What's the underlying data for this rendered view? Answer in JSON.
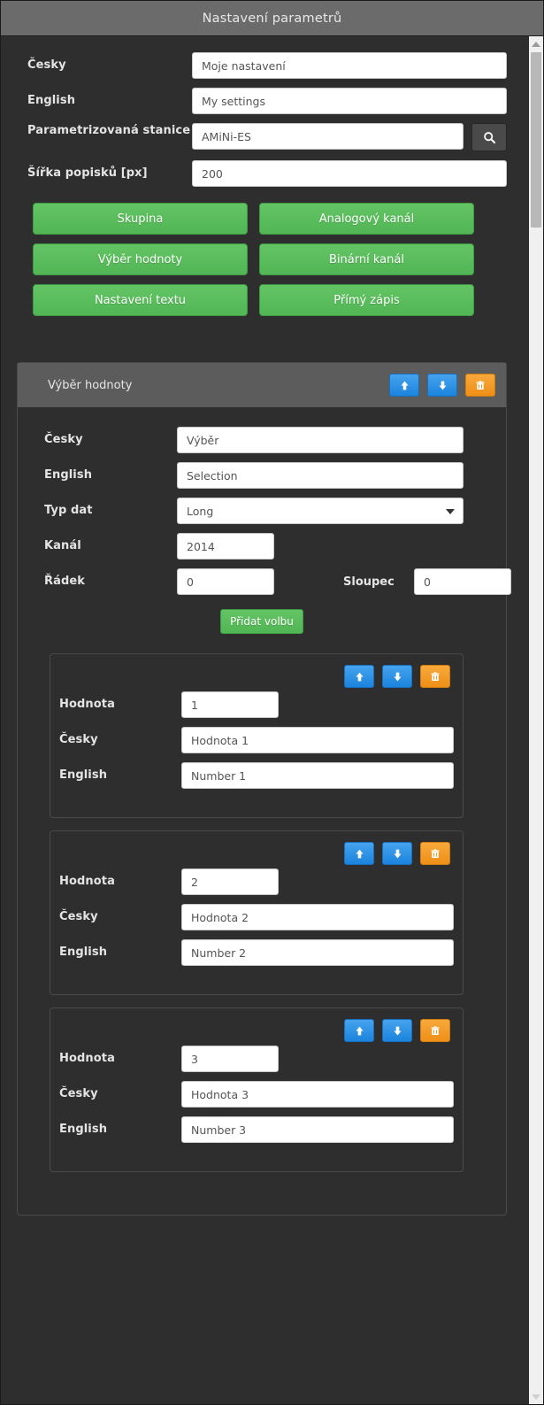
{
  "window": {
    "title": "Nastavení parametrů"
  },
  "top_form": {
    "fields": [
      {
        "label": "Česky",
        "value": "Moje nastavení"
      },
      {
        "label": "English",
        "value": "My settings"
      },
      {
        "label": "Parametrizovaná stanice",
        "value": "AMiNi-ES"
      },
      {
        "label": "Šířka popisků [px]",
        "value": "200"
      }
    ],
    "search_icon": "search-icon"
  },
  "action_buttons": [
    {
      "label": "Skupina"
    },
    {
      "label": "Analogový kanál"
    },
    {
      "label": "Výběr hodnoty"
    },
    {
      "label": "Binární kanál"
    },
    {
      "label": "Nastavení textu"
    },
    {
      "label": "Přímý zápis"
    }
  ],
  "panel": {
    "title": "Výběr hodnoty",
    "tools": [
      {
        "icon": "arrow-up-icon",
        "color": "#1b84dd"
      },
      {
        "icon": "arrow-down-icon",
        "color": "#1b84dd"
      },
      {
        "icon": "trash-icon",
        "color": "#ef8f18"
      }
    ],
    "fields": {
      "czech_label": "Česky",
      "czech_value": "Výběr",
      "english_label": "English",
      "english_value": "Selection",
      "datatype_label": "Typ dat",
      "datatype_value": "Long",
      "datatype_options": [
        "Long"
      ],
      "channel_label": "Kanál",
      "channel_value": "2014",
      "row_label": "Řádek",
      "row_value": "0",
      "column_label": "Sloupec",
      "column_value": "0"
    },
    "add_option_label": "Přidat volbu",
    "options": [
      {
        "value_label": "Hodnota",
        "value": "1",
        "czech_label": "Česky",
        "czech_value": "Hodnota 1",
        "english_label": "English",
        "english_value": "Number 1"
      },
      {
        "value_label": "Hodnota",
        "value": "2",
        "czech_label": "Česky",
        "czech_value": "Hodnota 2",
        "english_label": "English",
        "english_value": "Number 2"
      },
      {
        "value_label": "Hodnota",
        "value": "3",
        "czech_label": "Česky",
        "czech_value": "Hodnota 3",
        "english_label": "English",
        "english_value": "Number 3"
      }
    ]
  },
  "scrollbar": {
    "up_icon": "triangle-up-icon",
    "down_icon": "triangle-down-icon"
  },
  "colors": {
    "titlebar": "#6b6b6b",
    "background": "#2e2e2e",
    "panel_header": "#5c5c5c",
    "green": "#52b655",
    "blue": "#1b84dd",
    "orange": "#ef8f18"
  }
}
